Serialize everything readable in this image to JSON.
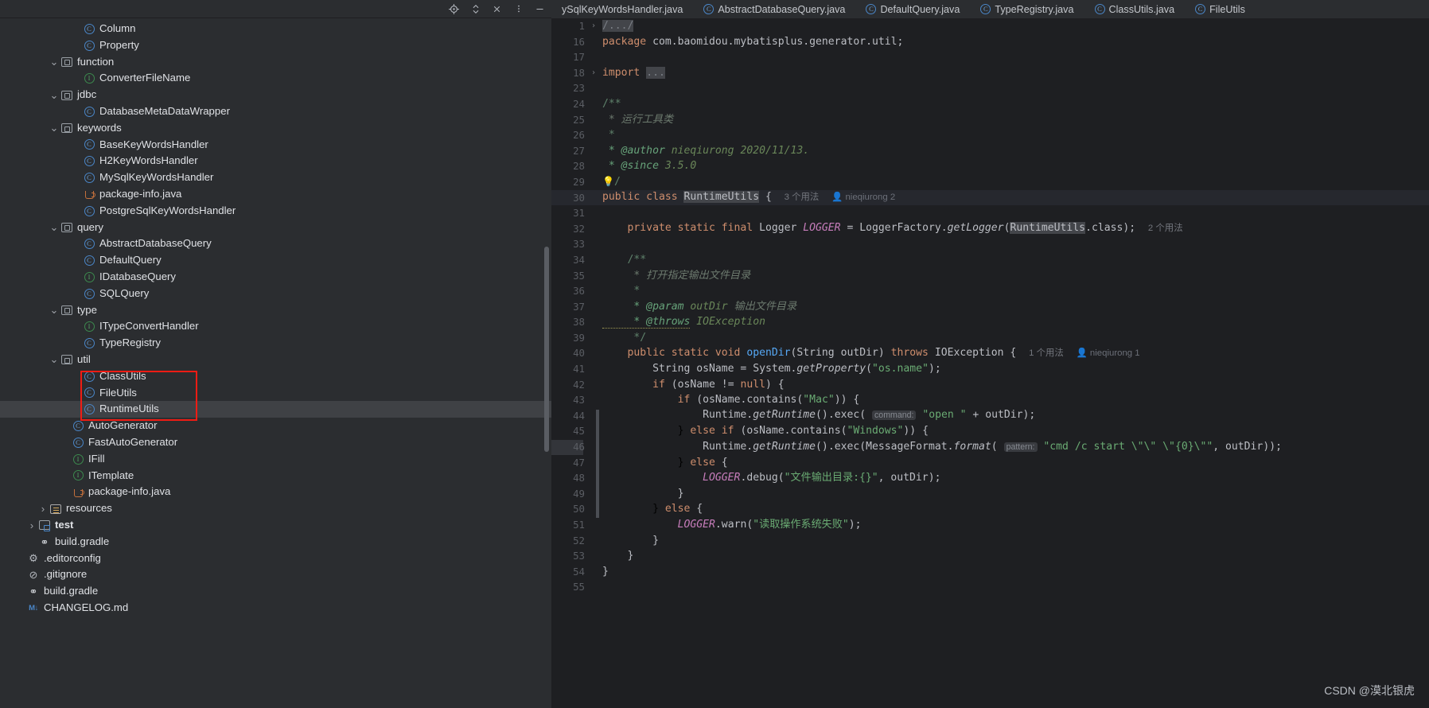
{
  "left_toolbar": {
    "icons": [
      {
        "name": "locate-icon",
        "glyph": "target"
      },
      {
        "name": "expand-collapse-icon",
        "glyph": "chevrons"
      },
      {
        "name": "close-icon",
        "glyph": "x"
      },
      {
        "name": "more-options-icon",
        "glyph": "dots"
      },
      {
        "name": "hide-icon",
        "glyph": "minus"
      }
    ]
  },
  "tree": {
    "items": [
      {
        "label": "Column",
        "icon": "class-icon",
        "indent": 6,
        "arrow": "none",
        "selected": false
      },
      {
        "label": "Property",
        "icon": "class-icon",
        "indent": 6,
        "arrow": "none",
        "selected": false
      },
      {
        "label": "function",
        "icon": "package-icon",
        "indent": 4,
        "arrow": "down",
        "selected": false
      },
      {
        "label": "ConverterFileName",
        "icon": "interface-icon",
        "indent": 6,
        "arrow": "none",
        "selected": false
      },
      {
        "label": "jdbc",
        "icon": "package-icon",
        "indent": 4,
        "arrow": "down",
        "selected": false
      },
      {
        "label": "DatabaseMetaDataWrapper",
        "icon": "class-icon",
        "indent": 6,
        "arrow": "none",
        "selected": false
      },
      {
        "label": "keywords",
        "icon": "package-icon",
        "indent": 4,
        "arrow": "down",
        "selected": false
      },
      {
        "label": "BaseKeyWordsHandler",
        "icon": "abstract-class-icon",
        "indent": 6,
        "arrow": "none",
        "selected": false
      },
      {
        "label": "H2KeyWordsHandler",
        "icon": "class-icon",
        "indent": 6,
        "arrow": "none",
        "selected": false
      },
      {
        "label": "MySqlKeyWordsHandler",
        "icon": "class-icon",
        "indent": 6,
        "arrow": "none",
        "selected": false
      },
      {
        "label": "package-info.java",
        "icon": "java-file-icon",
        "indent": 6,
        "arrow": "none",
        "selected": false
      },
      {
        "label": "PostgreSqlKeyWordsHandler",
        "icon": "class-icon",
        "indent": 6,
        "arrow": "none",
        "selected": false
      },
      {
        "label": "query",
        "icon": "package-icon",
        "indent": 4,
        "arrow": "down",
        "selected": false
      },
      {
        "label": "AbstractDatabaseQuery",
        "icon": "abstract-class-icon",
        "indent": 6,
        "arrow": "none",
        "selected": false
      },
      {
        "label": "DefaultQuery",
        "icon": "class-icon",
        "indent": 6,
        "arrow": "none",
        "selected": false
      },
      {
        "label": "IDatabaseQuery",
        "icon": "interface-icon",
        "indent": 6,
        "arrow": "none",
        "selected": false
      },
      {
        "label": "SQLQuery",
        "icon": "class-icon",
        "indent": 6,
        "arrow": "none",
        "selected": false
      },
      {
        "label": "type",
        "icon": "package-icon",
        "indent": 4,
        "arrow": "down",
        "selected": false
      },
      {
        "label": "ITypeConvertHandler",
        "icon": "interface-icon",
        "indent": 6,
        "arrow": "none",
        "selected": false
      },
      {
        "label": "TypeRegistry",
        "icon": "class-icon",
        "indent": 6,
        "arrow": "none",
        "selected": false
      },
      {
        "label": "util",
        "icon": "package-icon",
        "indent": 4,
        "arrow": "down",
        "selected": false
      },
      {
        "label": "ClassUtils",
        "icon": "abstract-class-icon",
        "indent": 6,
        "arrow": "none",
        "selected": false
      },
      {
        "label": "FileUtils",
        "icon": "class-icon",
        "indent": 6,
        "arrow": "none",
        "selected": false
      },
      {
        "label": "RuntimeUtils",
        "icon": "class-icon",
        "indent": 6,
        "arrow": "none",
        "selected": true
      },
      {
        "label": "AutoGenerator",
        "icon": "class-icon",
        "indent": 5,
        "arrow": "none",
        "selected": false
      },
      {
        "label": "FastAutoGenerator",
        "icon": "abstract-class-icon",
        "indent": 5,
        "arrow": "none",
        "selected": false
      },
      {
        "label": "IFill",
        "icon": "interface-icon",
        "indent": 5,
        "arrow": "none",
        "selected": false
      },
      {
        "label": "ITemplate",
        "icon": "interface-icon",
        "indent": 5,
        "arrow": "none",
        "selected": false
      },
      {
        "label": "package-info.java",
        "icon": "java-file-icon",
        "indent": 5,
        "arrow": "none",
        "selected": false
      },
      {
        "label": "resources",
        "icon": "resources-folder-icon",
        "indent": 3,
        "arrow": "right",
        "selected": false
      },
      {
        "label": "test",
        "icon": "test-folder-icon",
        "indent": 2,
        "arrow": "right",
        "selected": false,
        "bold": true
      },
      {
        "label": "build.gradle",
        "icon": "gradle-icon",
        "indent": 2,
        "arrow": "none",
        "selected": false
      },
      {
        "label": ".editorconfig",
        "icon": "gear-icon",
        "indent": 1,
        "arrow": "none",
        "selected": false
      },
      {
        "label": ".gitignore",
        "icon": "ignore-icon",
        "indent": 1,
        "arrow": "none",
        "selected": false
      },
      {
        "label": "build.gradle",
        "icon": "gradle-icon",
        "indent": 1,
        "arrow": "none",
        "selected": false
      },
      {
        "label": "CHANGELOG.md",
        "icon": "markdown-icon",
        "indent": 1,
        "arrow": "none",
        "selected": false
      }
    ]
  },
  "editor_tabs": [
    {
      "label": "ySqlKeyWordsHandler.java",
      "icon": "none"
    },
    {
      "label": "AbstractDatabaseQuery.java",
      "icon": "abstract-class-icon"
    },
    {
      "label": "DefaultQuery.java",
      "icon": "class-icon"
    },
    {
      "label": "TypeRegistry.java",
      "icon": "class-icon"
    },
    {
      "label": "ClassUtils.java",
      "icon": "abstract-class-icon"
    },
    {
      "label": "FileUtils",
      "icon": "class-icon"
    }
  ],
  "code": {
    "lines": [
      {
        "no": "1",
        "fold": "right",
        "highlight": false
      },
      {
        "no": "16",
        "fold": "",
        "highlight": false
      },
      {
        "no": "17",
        "fold": "",
        "highlight": false
      },
      {
        "no": "18",
        "fold": "right",
        "highlight": false
      },
      {
        "no": "23",
        "fold": "",
        "highlight": false
      },
      {
        "no": "24",
        "fold": "",
        "highlight": false
      },
      {
        "no": "25",
        "fold": "",
        "highlight": false
      },
      {
        "no": "26",
        "fold": "",
        "highlight": false
      },
      {
        "no": "27",
        "fold": "",
        "highlight": false
      },
      {
        "no": "28",
        "fold": "",
        "highlight": false
      },
      {
        "no": "29",
        "fold": "",
        "highlight": false
      },
      {
        "no": "30",
        "fold": "",
        "highlight": true
      },
      {
        "no": "31",
        "fold": "",
        "highlight": false
      },
      {
        "no": "32",
        "fold": "",
        "highlight": false
      },
      {
        "no": "33",
        "fold": "",
        "highlight": false
      },
      {
        "no": "34",
        "fold": "",
        "highlight": false
      },
      {
        "no": "35",
        "fold": "",
        "highlight": false
      },
      {
        "no": "36",
        "fold": "",
        "highlight": false
      },
      {
        "no": "37",
        "fold": "",
        "highlight": false
      },
      {
        "no": "38",
        "fold": "",
        "highlight": false
      },
      {
        "no": "39",
        "fold": "",
        "highlight": false
      },
      {
        "no": "40",
        "fold": "",
        "highlight": false
      },
      {
        "no": "41",
        "fold": "",
        "highlight": false
      },
      {
        "no": "42",
        "fold": "",
        "highlight": false
      },
      {
        "no": "43",
        "fold": "",
        "highlight": false
      },
      {
        "no": "44",
        "fold": "",
        "highlight": false
      },
      {
        "no": "45",
        "fold": "",
        "highlight": false
      },
      {
        "no": "46",
        "fold": "",
        "highlight": false
      },
      {
        "no": "47",
        "fold": "",
        "highlight": false
      },
      {
        "no": "48",
        "fold": "",
        "highlight": false
      },
      {
        "no": "49",
        "fold": "",
        "highlight": false
      },
      {
        "no": "50",
        "fold": "",
        "highlight": false
      },
      {
        "no": "51",
        "fold": "",
        "highlight": false
      },
      {
        "no": "52",
        "fold": "",
        "highlight": false
      },
      {
        "no": "53",
        "fold": "",
        "highlight": false
      },
      {
        "no": "54",
        "fold": "",
        "highlight": false
      },
      {
        "no": "55",
        "fold": "",
        "highlight": false
      }
    ],
    "text": {
      "l1_folded_comment": "/.../",
      "l16_package_kw": "package",
      "l16_package_name": " com.baomidou.mybatisplus.generator.util;",
      "l18_import_kw": "import",
      "l18_import_ellipsis": "...",
      "l24_doc_open": "/**",
      "l25_doc": " * 运行工具类",
      "l26_doc": " *",
      "l27_doc_tag": " * @author",
      "l27_doc_rest": " nieqiurong 2020/11/13.",
      "l28_doc_tag": " * @since",
      "l28_doc_rest": " 3.5.0",
      "l29_doc_close": "/",
      "l30_a": "public class ",
      "l30_name": "RuntimeUtils",
      "l30_b": " {",
      "l30_usage": "3 个用法",
      "l30_author": "nieqiurong 2",
      "l32_a": "    private static final ",
      "l32_logger_t": "Logger ",
      "l32_const": "LOGGER",
      "l32_eq": " = ",
      "l32_factory": "LoggerFactory.",
      "l32_getlogger": "getLogger",
      "l32_paren": "(",
      "l32_cls": "RuntimeUtils",
      "l32_tail": ".class);",
      "l32_usage": "2 个用法",
      "l34_doc": "    /**",
      "l35_doc": "     * 打开指定输出文件目录",
      "l36_doc": "     *",
      "l37_doc_tag": "     * @param",
      "l37_doc_param": " outDir ",
      "l37_doc_cn": "输出文件目录",
      "l38_doc_tag": "     * @throws",
      "l38_doc_rest": " IOException",
      "l39_doc": "     */",
      "l40_kw1": "    public static void ",
      "l40_fn": "openDir",
      "l40_args": "(String outDir) ",
      "l40_kw2": "throws",
      "l40_exc": " IOException {",
      "l40_usage": "1 个用法",
      "l40_author": "nieqiurong 1",
      "l41_a": "        String osName = System.",
      "l41_fn": "getProperty",
      "l41_b": "(",
      "l41_str": "\"os.name\"",
      "l41_c": ");",
      "l42_a": "        ",
      "l42_kw": "if",
      "l42_b": " (osName != ",
      "l42_null": "null",
      "l42_c": ") {",
      "l43_a": "            ",
      "l43_kw": "if",
      "l43_b": " (osName.contains(",
      "l43_str": "\"Mac\"",
      "l43_c": ")) {",
      "l44_a": "                Runtime.",
      "l44_fn": "getRuntime",
      "l44_b": "().exec( ",
      "l44_pill": "command:",
      "l44_str": " \"open \"",
      "l44_c": " + outDir);",
      "l45_a": "            } ",
      "l45_kw": "else if",
      "l45_b": " (osName.contains(",
      "l45_str": "\"Windows\"",
      "l45_c": ")) {",
      "l46_a": "                Runtime.",
      "l46_fn": "getRuntime",
      "l46_b": "().exec(MessageFormat.",
      "l46_fmt": "format",
      "l46_c": "( ",
      "l46_pill": "pattern:",
      "l46_str": " \"cmd /c start \\\"\\\" \\\"{0}\\\"\"",
      "l46_d": ", outDir));",
      "l47_a": "            } ",
      "l47_kw": "else",
      "l47_b": " {",
      "l48_a": "                ",
      "l48_const": "LOGGER",
      "l48_b": ".debug(",
      "l48_str": "\"文件输出目录:{}\"",
      "l48_c": ", outDir);",
      "l49": "            }",
      "l50_a": "        } ",
      "l50_kw": "else",
      "l50_b": " {",
      "l51_a": "            ",
      "l51_const": "LOGGER",
      "l51_b": ".warn(",
      "l51_str": "\"读取操作系统失败\"",
      "l51_c": ");",
      "l52": "        }",
      "l53": "    }",
      "l54": "}",
      "l55": ""
    }
  },
  "watermark": "CSDN @漠北银虎",
  "colors": {
    "panel_bg": "#2b2d30",
    "editor_bg": "#1e1f22",
    "selection": "#3f4145",
    "annotation_red": "#f01c14",
    "keyword": "#cf8e6d",
    "string": "#6aab73",
    "comment": "#7a7e85",
    "doc_comment": "#5f826b",
    "method": "#56a8f5",
    "constant": "#c77dbb"
  }
}
